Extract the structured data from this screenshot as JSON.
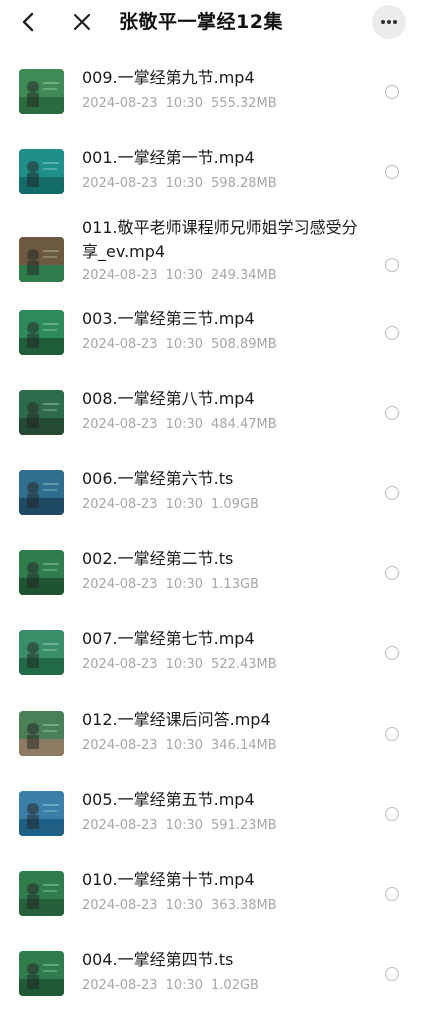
{
  "header": {
    "title": "张敬平一掌经12集",
    "back_icon": "back-arrow-icon",
    "close_icon": "close-icon",
    "more_icon": "more-options-icon"
  },
  "files": [
    {
      "name": "009.一掌经第九节.mp4",
      "date": "2024-08-23",
      "time": "10:30",
      "size": "555.32MB"
    },
    {
      "name": "001.一掌经第一节.mp4",
      "date": "2024-08-23",
      "time": "10:30",
      "size": "598.28MB"
    },
    {
      "name": "011.敬平老师课程师兄师姐学习感受分享_ev.mp4",
      "date": "2024-08-23",
      "time": "10:30",
      "size": "249.34MB"
    },
    {
      "name": "003.一掌经第三节.mp4",
      "date": "2024-08-23",
      "time": "10:30",
      "size": "508.89MB"
    },
    {
      "name": "008.一掌经第八节.mp4",
      "date": "2024-08-23",
      "time": "10:30",
      "size": "484.47MB"
    },
    {
      "name": "006.一掌经第六节.ts",
      "date": "2024-08-23",
      "time": "10:30",
      "size": "1.09GB"
    },
    {
      "name": "002.一掌经第二节.ts",
      "date": "2024-08-23",
      "time": "10:30",
      "size": "1.13GB"
    },
    {
      "name": "007.一掌经第七节.mp4",
      "date": "2024-08-23",
      "time": "10:30",
      "size": "522.43MB"
    },
    {
      "name": "012.一掌经课后问答.mp4",
      "date": "2024-08-23",
      "time": "10:30",
      "size": "346.14MB"
    },
    {
      "name": "005.一掌经第五节.mp4",
      "date": "2024-08-23",
      "time": "10:30",
      "size": "591.23MB"
    },
    {
      "name": "010.一掌经第十节.mp4",
      "date": "2024-08-23",
      "time": "10:30",
      "size": "363.38MB"
    },
    {
      "name": "004.一掌经第四节.ts",
      "date": "2024-08-23",
      "time": "10:30",
      "size": "1.02GB"
    }
  ]
}
